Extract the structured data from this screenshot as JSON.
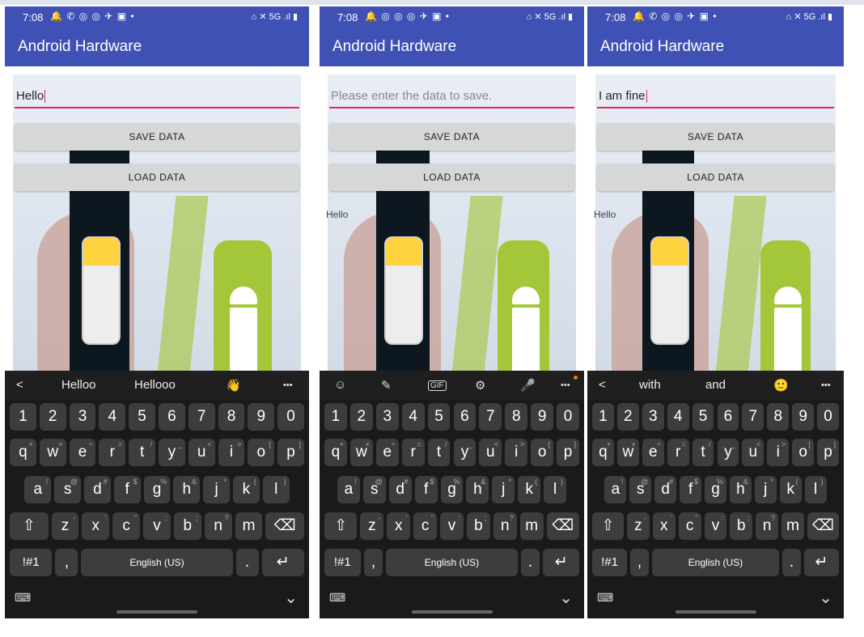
{
  "app": {
    "title": "Android Hardware"
  },
  "screens": [
    {
      "status_time": "7:08",
      "status_icons": "🔔 ✆ ◎ ◎ ✈ ▣ •",
      "status_sys": "⌂ ✕ 5G .ıl ▮",
      "input_value": "Hello",
      "input_placeholder": "",
      "save_label": "SAVE DATA",
      "load_label": "LOAD DATA",
      "loaded_text": "",
      "suggestions": [
        "<",
        "Helloo",
        "Hellooo",
        "👋",
        "•••"
      ],
      "english": "English (US)"
    },
    {
      "status_time": "7:08",
      "status_icons": "🔔 ◎ ◎ ◎ ✈ ▣ •",
      "status_sys": "⌂ ✕ 5G .ıl ▮",
      "input_value": "",
      "input_placeholder": "Please enter the data to save.",
      "save_label": "SAVE DATA",
      "load_label": "LOAD DATA",
      "loaded_text": "Hello",
      "tools": [
        "☺",
        "✎",
        "GIF",
        "⚙",
        "🎤",
        "•••"
      ],
      "english": "English (US)"
    },
    {
      "status_time": "7:08",
      "status_icons": "🔔 ✆ ◎ ◎ ✈ ▣ •",
      "status_sys": "⌂ ✕ 5G .ıl ▮",
      "input_value": "I am fine",
      "input_placeholder": "",
      "save_label": "SAVE DATA",
      "load_label": "LOAD DATA",
      "loaded_text": "Hello",
      "suggestions": [
        "<",
        "with",
        "and",
        "🙂",
        "•••"
      ],
      "english": "English (US)"
    }
  ],
  "keyboard": {
    "row_numbers": [
      "1",
      "2",
      "3",
      "4",
      "5",
      "6",
      "7",
      "8",
      "9",
      "0"
    ],
    "row_q": [
      "q",
      "w",
      "e",
      "r",
      "t",
      "y",
      "u",
      "i",
      "o",
      "p"
    ],
    "row_a": [
      "a",
      "s",
      "d",
      "f",
      "g",
      "h",
      "j",
      "k",
      "l"
    ],
    "row_z": [
      "⇧",
      "z",
      "x",
      "c",
      "v",
      "b",
      "n",
      "m",
      "⌫"
    ],
    "row_bottom": [
      "!#1",
      ",",
      "English (US)",
      ".",
      "↵"
    ],
    "bottom_left_icon": "⌨",
    "bottom_right_icon": "⌄"
  }
}
